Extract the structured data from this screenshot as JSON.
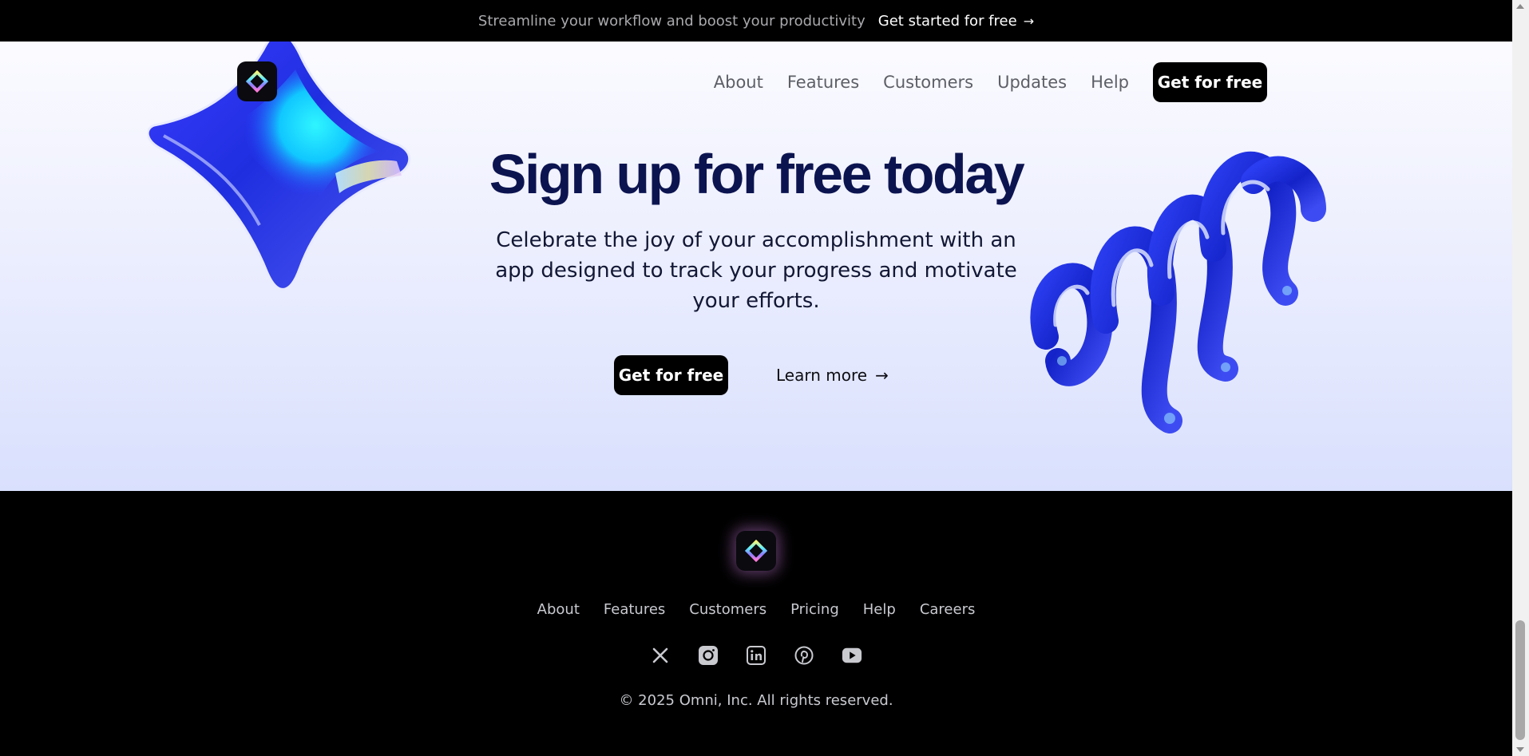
{
  "announcement": {
    "message": "Streamline your workflow and boost your productivity",
    "cta_label": "Get started for free",
    "cta_arrow": "→"
  },
  "nav": {
    "items": [
      "About",
      "Features",
      "Customers",
      "Updates",
      "Help"
    ],
    "cta_label": "Get for free"
  },
  "hero": {
    "title": "Sign up for free today",
    "subtitle": "Celebrate the joy of your accomplishment with an app designed to track your progress and motivate your efforts.",
    "primary_label": "Get for free",
    "secondary_label": "Learn more",
    "secondary_arrow": "→"
  },
  "footer": {
    "links": [
      "About",
      "Features",
      "Customers",
      "Pricing",
      "Help",
      "Careers"
    ],
    "social_icons": [
      "x-icon",
      "instagram-icon",
      "linkedin-icon",
      "pinterest-icon",
      "youtube-icon"
    ],
    "copyright": "© 2025 Omni, Inc. All rights reserved."
  },
  "colors": {
    "title": "#0c1450",
    "dark": "#000000",
    "hero_gradient_top": "#fbfbff",
    "hero_gradient_bottom": "#d9e0fd",
    "accent_blue": "#1a2fd8"
  }
}
